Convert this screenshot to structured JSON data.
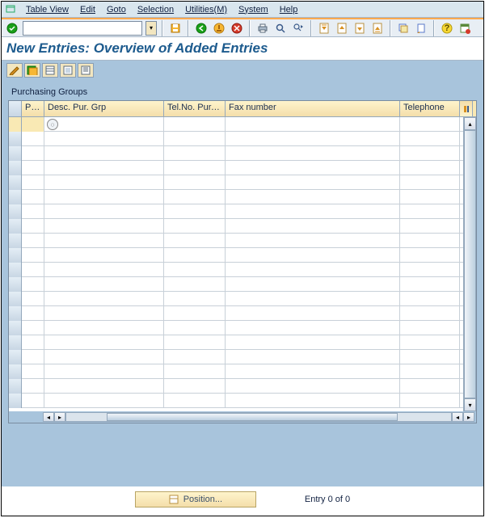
{
  "menu": {
    "tableview": "Table View",
    "edit": "Edit",
    "goto": "Goto",
    "selection": "Selection",
    "utilities": "Utilities(M)",
    "system": "System",
    "help": "Help"
  },
  "okcode": {
    "value": ""
  },
  "page_title": "New Entries: Overview of Added Entries",
  "panel": {
    "title": "Purchasing Groups"
  },
  "columns": {
    "pu": "Pu...",
    "desc": "Desc. Pur. Grp",
    "telno": "Tel.No. Pur.Grp",
    "fax": "Fax number",
    "telephone": "Telephone"
  },
  "rows": [
    {
      "pu": "",
      "desc": "",
      "telno": "",
      "fax": "",
      "telephone": ""
    },
    {
      "pu": "",
      "desc": "",
      "telno": "",
      "fax": "",
      "telephone": ""
    },
    {
      "pu": "",
      "desc": "",
      "telno": "",
      "fax": "",
      "telephone": ""
    },
    {
      "pu": "",
      "desc": "",
      "telno": "",
      "fax": "",
      "telephone": ""
    },
    {
      "pu": "",
      "desc": "",
      "telno": "",
      "fax": "",
      "telephone": ""
    },
    {
      "pu": "",
      "desc": "",
      "telno": "",
      "fax": "",
      "telephone": ""
    },
    {
      "pu": "",
      "desc": "",
      "telno": "",
      "fax": "",
      "telephone": ""
    },
    {
      "pu": "",
      "desc": "",
      "telno": "",
      "fax": "",
      "telephone": ""
    },
    {
      "pu": "",
      "desc": "",
      "telno": "",
      "fax": "",
      "telephone": ""
    },
    {
      "pu": "",
      "desc": "",
      "telno": "",
      "fax": "",
      "telephone": ""
    },
    {
      "pu": "",
      "desc": "",
      "telno": "",
      "fax": "",
      "telephone": ""
    },
    {
      "pu": "",
      "desc": "",
      "telno": "",
      "fax": "",
      "telephone": ""
    },
    {
      "pu": "",
      "desc": "",
      "telno": "",
      "fax": "",
      "telephone": ""
    },
    {
      "pu": "",
      "desc": "",
      "telno": "",
      "fax": "",
      "telephone": ""
    },
    {
      "pu": "",
      "desc": "",
      "telno": "",
      "fax": "",
      "telephone": ""
    },
    {
      "pu": "",
      "desc": "",
      "telno": "",
      "fax": "",
      "telephone": ""
    },
    {
      "pu": "",
      "desc": "",
      "telno": "",
      "fax": "",
      "telephone": ""
    },
    {
      "pu": "",
      "desc": "",
      "telno": "",
      "fax": "",
      "telephone": ""
    },
    {
      "pu": "",
      "desc": "",
      "telno": "",
      "fax": "",
      "telephone": ""
    },
    {
      "pu": "",
      "desc": "",
      "telno": "",
      "fax": "",
      "telephone": ""
    }
  ],
  "position_button": {
    "label": "Position..."
  },
  "entry_counter": "Entry 0 of 0",
  "colors": {
    "accent": "#1d5b8e",
    "highlight": "#f9e9b4",
    "panel": "#a8c4dc"
  },
  "icons": {
    "check": "check-icon",
    "save": "save-icon",
    "back": "back-icon",
    "exit": "exit-icon",
    "cancel": "cancel-icon",
    "print": "print-icon",
    "find": "find-icon",
    "findnext": "findnext-icon",
    "firstpage": "firstpage-icon",
    "prevpage": "prevpage-icon",
    "nextpage": "nextpage-icon",
    "lastpage": "lastpage-icon",
    "newsession": "newsession-icon",
    "shortcut": "shortcut-icon",
    "help": "help-icon",
    "layout": "layout-icon"
  }
}
